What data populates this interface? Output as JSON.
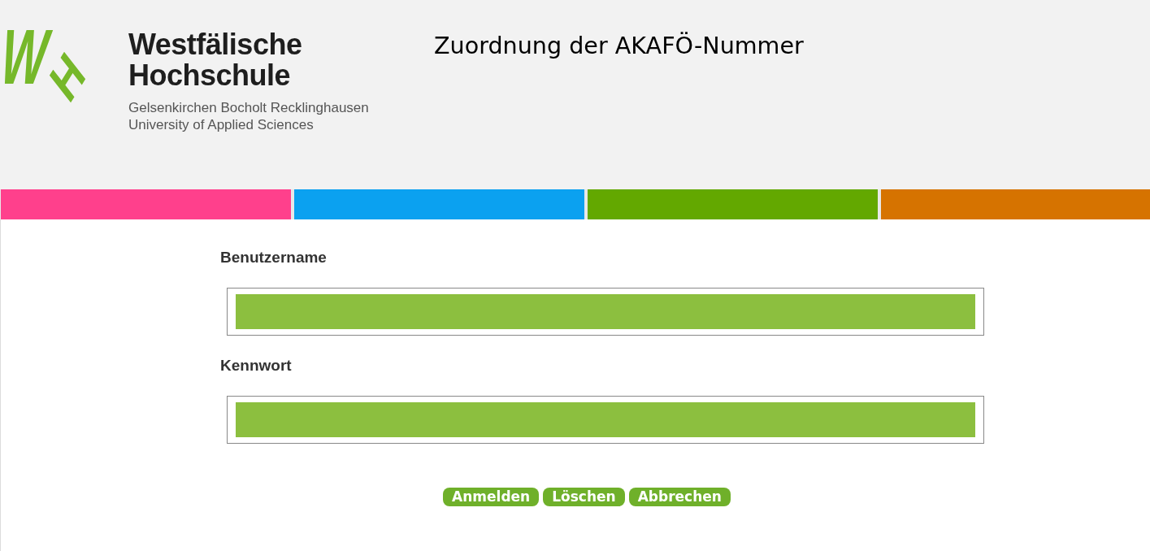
{
  "logo": {
    "mark": [
      "W",
      "H"
    ],
    "name_lines": [
      "Westfälische",
      "Hochschule"
    ],
    "subtitle_lines": [
      "Gelsenkirchen Bocholt Recklinghausen",
      "University of Applied Sciences"
    ]
  },
  "page_title": "Zuordnung der AKAFÖ-Nummer",
  "color_stripes": [
    {
      "color": "#ff408c"
    },
    {
      "color": "#0ba1f0"
    },
    {
      "color": "#63a800"
    },
    {
      "color": "#d67300"
    }
  ],
  "form": {
    "fields": [
      {
        "label": "Benutzername"
      },
      {
        "label": "Kennwort"
      }
    ]
  },
  "buttons": [
    "Anmelden",
    "Löschen",
    "Abbrechen"
  ]
}
